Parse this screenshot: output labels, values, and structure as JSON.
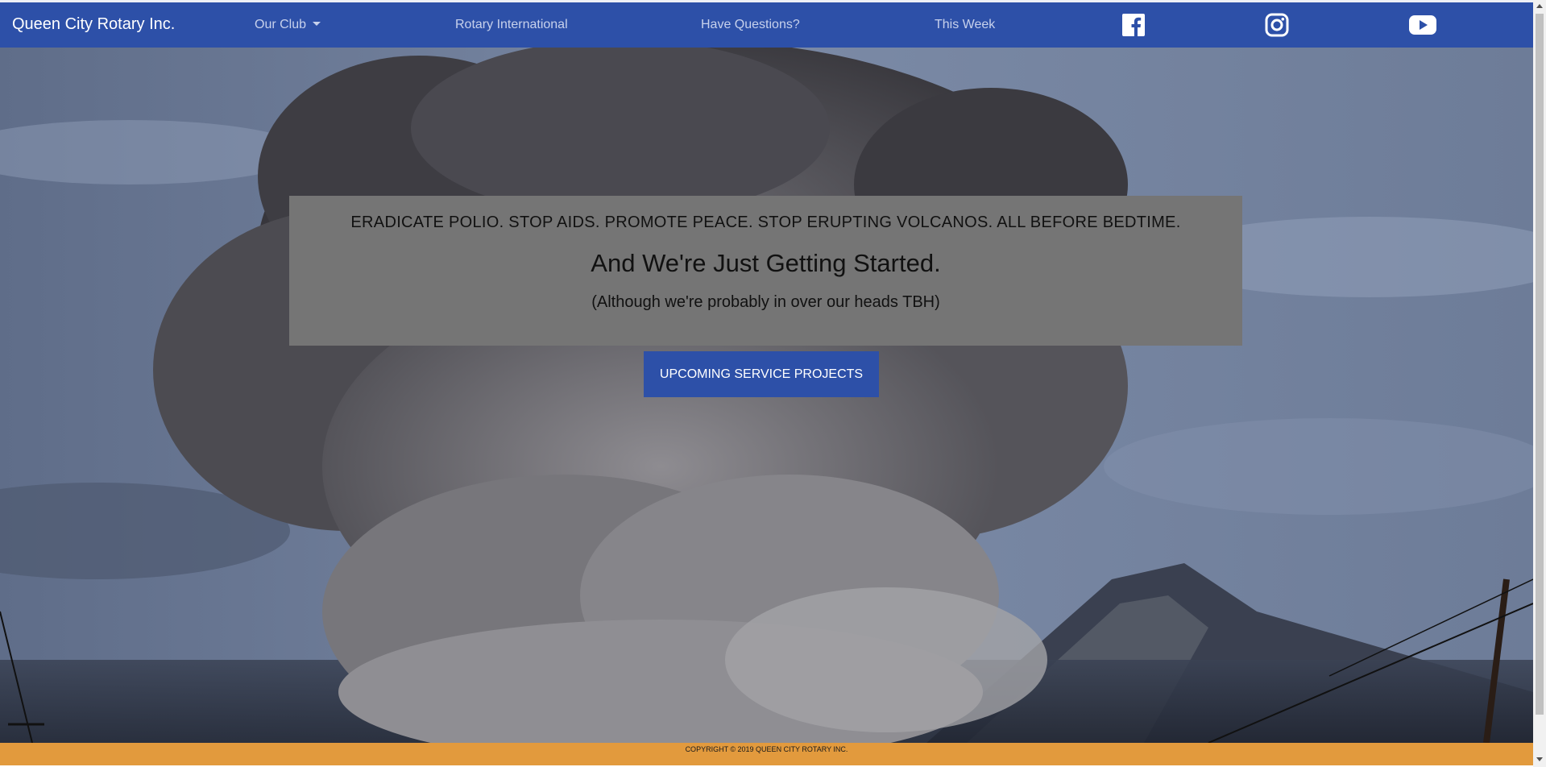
{
  "navbar": {
    "brand": "Queen City Rotary Inc.",
    "links": [
      {
        "label": "Our Club",
        "dropdown": true
      },
      {
        "label": "Rotary International"
      },
      {
        "label": "Have Questions?"
      },
      {
        "label": "This Week"
      }
    ],
    "social": [
      "facebook-icon",
      "instagram-icon",
      "youtube-icon"
    ],
    "background": "#2d50a8"
  },
  "hero": {
    "tagline": "ERADICATE POLIO. STOP AIDS. PROMOTE PEACE. STOP ERUPTING VOLCANOS. ALL BEFORE BEDTIME.",
    "headline": "And We're Just Getting Started.",
    "subline": "(Although we're probably in over our heads TBH)",
    "cta_label": "UPCOMING SERVICE PROJECTS",
    "image": "volcano-eruption-ash-cloud"
  },
  "footer": {
    "copyright": "COPYRIGHT © 2019 QUEEN CITY ROTARY INC.",
    "background": "#e29a3d"
  }
}
